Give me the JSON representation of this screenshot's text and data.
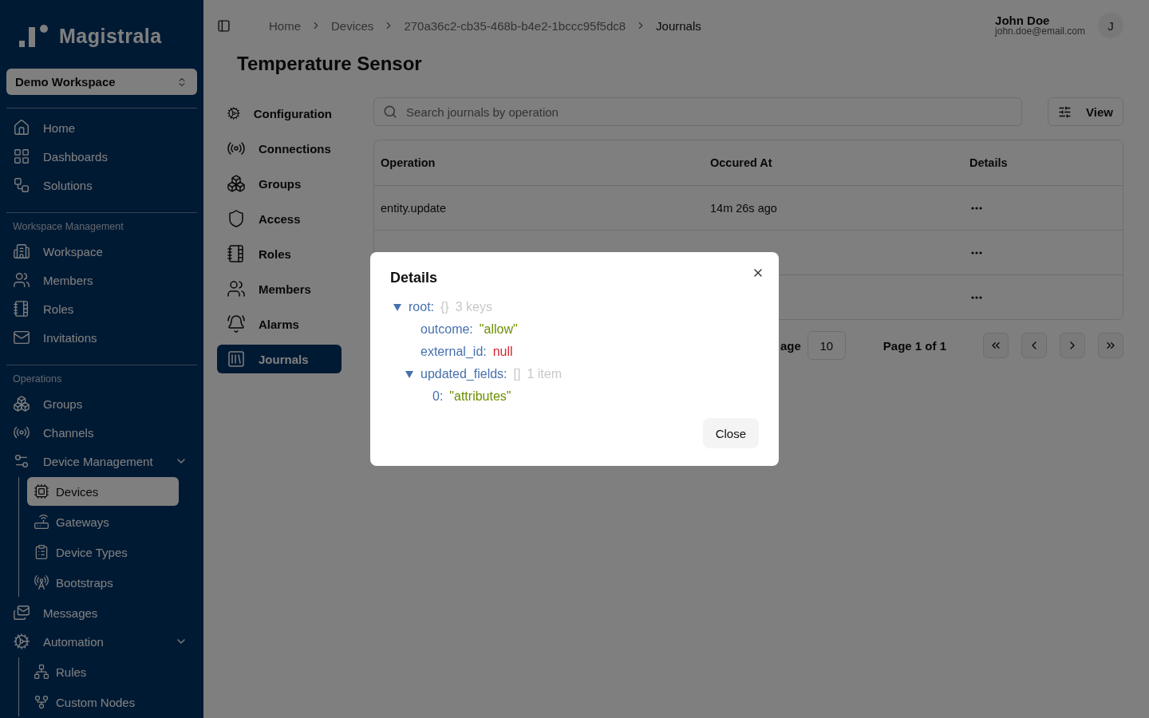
{
  "sidebar": {
    "brand": "Magistrala",
    "workspace_selector": "Demo Workspace",
    "sections": [
      {
        "items": [
          {
            "label": "Home",
            "selected": false
          },
          {
            "label": "Dashboards",
            "selected": false
          },
          {
            "label": "Solutions",
            "selected": false
          }
        ]
      },
      {
        "heading": "Workspace Management",
        "items": [
          {
            "label": "Workspace",
            "selected": false
          },
          {
            "label": "Members",
            "selected": false
          },
          {
            "label": "Roles",
            "selected": false
          },
          {
            "label": "Invitations",
            "selected": false
          }
        ]
      },
      {
        "heading": "Operations",
        "items": [
          {
            "label": "Groups",
            "selected": false
          },
          {
            "label": "Channels",
            "selected": false
          },
          {
            "label": "Device Management",
            "selected": false,
            "expanded": true,
            "children": [
              {
                "label": "Devices",
                "selected": true
              },
              {
                "label": "Gateways",
                "selected": false
              },
              {
                "label": "Device Types",
                "selected": false
              },
              {
                "label": "Bootstraps",
                "selected": false
              }
            ]
          },
          {
            "label": "Messages",
            "selected": false
          },
          {
            "label": "Automation",
            "selected": false,
            "expanded": true,
            "children": [
              {
                "label": "Rules",
                "selected": false
              },
              {
                "label": "Custom Nodes",
                "selected": false
              }
            ]
          }
        ]
      }
    ]
  },
  "breadcrumbs": [
    "Home",
    "Devices",
    "270a36c2-cb35-468b-b4e2-1bccc95f5dc8",
    "Journals"
  ],
  "user": {
    "name": "John Doe",
    "email": "john.doe@email.com",
    "initial": "J"
  },
  "page_title": "Temperature Sensor",
  "entity_tabs": [
    {
      "label": "Configuration",
      "selected": false
    },
    {
      "label": "Connections",
      "selected": false
    },
    {
      "label": "Groups",
      "selected": false
    },
    {
      "label": "Access",
      "selected": false
    },
    {
      "label": "Roles",
      "selected": false
    },
    {
      "label": "Members",
      "selected": false
    },
    {
      "label": "Alarms",
      "selected": false
    },
    {
      "label": "Journals",
      "selected": true
    }
  ],
  "search": {
    "placeholder": "Search journals by operation"
  },
  "view_button": "View",
  "table": {
    "columns": [
      "Operation",
      "Occured At",
      "Details"
    ],
    "rows": [
      {
        "operation": "entity.update",
        "occurred_at": "14m 26s ago"
      },
      {
        "operation": null,
        "occurred_at": null
      },
      {
        "operation": null,
        "occurred_at": null
      }
    ]
  },
  "pagination": {
    "rows_label": "age",
    "page_size": "10",
    "page_info": "Page 1 of 1"
  },
  "details_dialog": {
    "title": "Details",
    "close_button": "Close",
    "tree": {
      "key": "root:",
      "kind": "object",
      "expanded": true,
      "brace": "{}",
      "summary": "3 keys",
      "children": [
        {
          "key": "outcome:",
          "kind": "string",
          "value": "\"allow\""
        },
        {
          "key": "external_id:",
          "kind": "null",
          "value": "null"
        },
        {
          "key": "updated_fields:",
          "kind": "array",
          "expanded": true,
          "brace": "[]",
          "summary": "1 item",
          "children": [
            {
              "key": "0:",
              "kind": "string",
              "value": "\"attributes\""
            }
          ]
        }
      ]
    }
  }
}
